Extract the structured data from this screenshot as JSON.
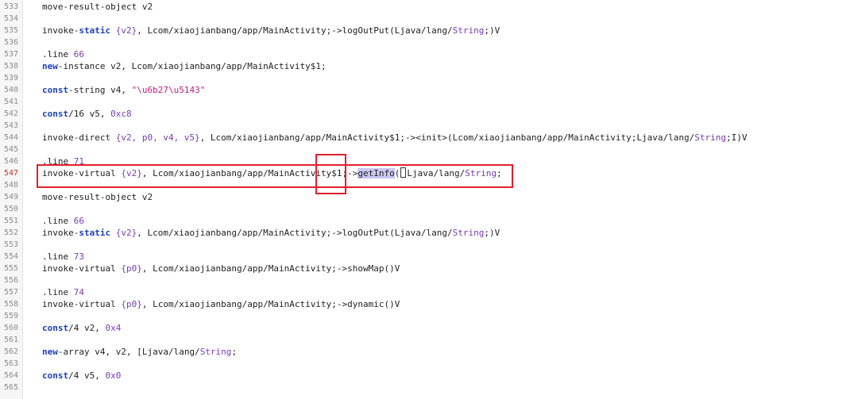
{
  "editor": {
    "lines": [
      {
        "num": "533",
        "tokens": [
          {
            "t": "move-result-object v2",
            "c": ""
          }
        ]
      },
      {
        "num": "534",
        "tokens": []
      },
      {
        "num": "535",
        "tokens": [
          {
            "t": "invoke-",
            "c": ""
          },
          {
            "t": "static",
            "c": "kw"
          },
          {
            "t": " ",
            "c": ""
          },
          {
            "t": "{v2}",
            "c": "reg"
          },
          {
            "t": ", Lcom/xiaojianbang/app/MainActivity;->logOutPut(Ljava/lang/",
            "c": ""
          },
          {
            "t": "String",
            "c": "cls"
          },
          {
            "t": ";)V",
            "c": ""
          }
        ]
      },
      {
        "num": "536",
        "tokens": []
      },
      {
        "num": "537",
        "tokens": [
          {
            "t": ".line ",
            "c": ""
          },
          {
            "t": "66",
            "c": "num"
          }
        ]
      },
      {
        "num": "538",
        "tokens": [
          {
            "t": "new",
            "c": "kw"
          },
          {
            "t": "-instance v2, Lcom/xiaojianbang/app/MainActivity$1;",
            "c": ""
          }
        ]
      },
      {
        "num": "539",
        "tokens": []
      },
      {
        "num": "540",
        "tokens": [
          {
            "t": "const",
            "c": "kw"
          },
          {
            "t": "-string v4, ",
            "c": ""
          },
          {
            "t": "\"\\u6b27\\u5143\"",
            "c": "str"
          }
        ]
      },
      {
        "num": "541",
        "tokens": []
      },
      {
        "num": "542",
        "tokens": [
          {
            "t": "const",
            "c": "kw"
          },
          {
            "t": "/16 v5, ",
            "c": ""
          },
          {
            "t": "0xc8",
            "c": "num"
          }
        ]
      },
      {
        "num": "543",
        "tokens": []
      },
      {
        "num": "544",
        "tokens": [
          {
            "t": "invoke-direct ",
            "c": ""
          },
          {
            "t": "{v2, p0, v4, v5}",
            "c": "reg"
          },
          {
            "t": ", Lcom/xiaojianbang/app/MainActivity$1;-><init>(Lcom/xiaojianbang/app/MainActivity;Ljava/lang/",
            "c": ""
          },
          {
            "t": "String",
            "c": "cls"
          },
          {
            "t": ";I)V",
            "c": ""
          }
        ]
      },
      {
        "num": "545",
        "tokens": []
      },
      {
        "num": "546",
        "tokens": [
          {
            "t": ".line ",
            "c": ""
          },
          {
            "t": "71",
            "c": "num"
          }
        ]
      },
      {
        "num": "547",
        "current": true,
        "tokens": [
          {
            "t": "invoke-virtual ",
            "c": ""
          },
          {
            "t": "{v2}",
            "c": "reg"
          },
          {
            "t": ", Lcom/xiaojianbang/app/MainActivity$1;->",
            "c": ""
          },
          {
            "t": "getInfo",
            "c": "hl"
          },
          {
            "t": "(",
            "c": ""
          },
          {
            "t": "",
            "c": "caret"
          },
          {
            "t": "Ljava/lang/",
            "c": ""
          },
          {
            "t": "String",
            "c": "cls"
          },
          {
            "t": ";",
            "c": ""
          }
        ]
      },
      {
        "num": "548",
        "tokens": []
      },
      {
        "num": "549",
        "tokens": [
          {
            "t": "move-result-object v2",
            "c": ""
          }
        ]
      },
      {
        "num": "550",
        "tokens": []
      },
      {
        "num": "551",
        "tokens": [
          {
            "t": ".line ",
            "c": ""
          },
          {
            "t": "66",
            "c": "num"
          }
        ]
      },
      {
        "num": "552",
        "tokens": [
          {
            "t": "invoke-",
            "c": ""
          },
          {
            "t": "static",
            "c": "kw"
          },
          {
            "t": " ",
            "c": ""
          },
          {
            "t": "{v2}",
            "c": "reg"
          },
          {
            "t": ", Lcom/xiaojianbang/app/MainActivity;->logOutPut(Ljava/lang/",
            "c": ""
          },
          {
            "t": "String",
            "c": "cls"
          },
          {
            "t": ";)V",
            "c": ""
          }
        ]
      },
      {
        "num": "553",
        "tokens": []
      },
      {
        "num": "554",
        "tokens": [
          {
            "t": ".line ",
            "c": ""
          },
          {
            "t": "73",
            "c": "num"
          }
        ]
      },
      {
        "num": "555",
        "tokens": [
          {
            "t": "invoke-virtual ",
            "c": ""
          },
          {
            "t": "{p0}",
            "c": "reg"
          },
          {
            "t": ", Lcom/xiaojianbang/app/MainActivity;->showMap()V",
            "c": ""
          }
        ]
      },
      {
        "num": "556",
        "tokens": []
      },
      {
        "num": "557",
        "tokens": [
          {
            "t": ".line ",
            "c": ""
          },
          {
            "t": "74",
            "c": "num"
          }
        ]
      },
      {
        "num": "558",
        "tokens": [
          {
            "t": "invoke-virtual ",
            "c": ""
          },
          {
            "t": "{p0}",
            "c": "reg"
          },
          {
            "t": ", Lcom/xiaojianbang/app/MainActivity;->dynamic()V",
            "c": ""
          }
        ]
      },
      {
        "num": "559",
        "tokens": []
      },
      {
        "num": "560",
        "tokens": [
          {
            "t": "const",
            "c": "kw"
          },
          {
            "t": "/4 v2, ",
            "c": ""
          },
          {
            "t": "0x4",
            "c": "num"
          }
        ]
      },
      {
        "num": "561",
        "tokens": []
      },
      {
        "num": "562",
        "tokens": [
          {
            "t": "new",
            "c": "kw"
          },
          {
            "t": "-array v4, v2, [Ljava/lang/",
            "c": ""
          },
          {
            "t": "String",
            "c": "cls"
          },
          {
            "t": ";",
            "c": ""
          }
        ]
      },
      {
        "num": "563",
        "tokens": []
      },
      {
        "num": "564",
        "tokens": [
          {
            "t": "const",
            "c": "kw"
          },
          {
            "t": "/4 v5, ",
            "c": ""
          },
          {
            "t": "0x0",
            "c": "num"
          }
        ]
      },
      {
        "num": "565",
        "tokens": []
      }
    ]
  },
  "colors": {
    "keyword": "#1a3fbf",
    "register": "#7a3cb3",
    "string": "#c0208a",
    "highlight": "#c7c7f2",
    "annotation_red": "#e0212e",
    "current_line_number": "#c0392b"
  }
}
